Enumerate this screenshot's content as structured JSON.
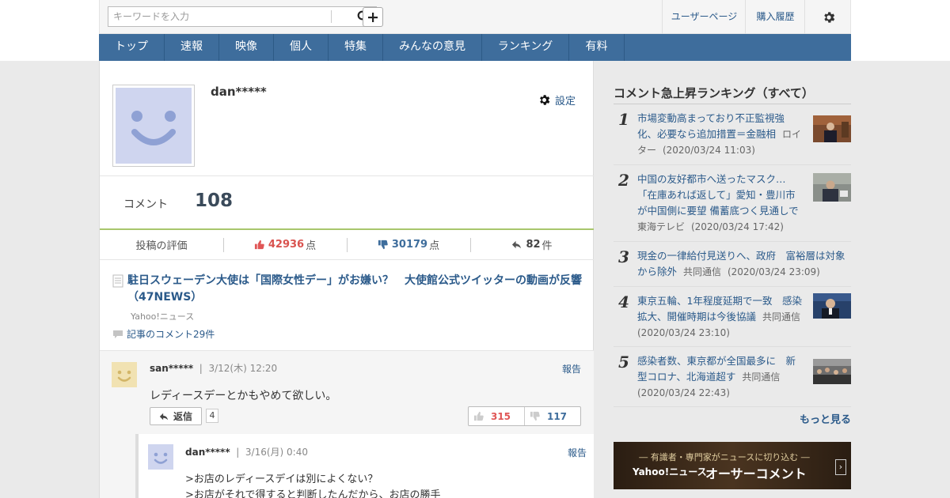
{
  "header": {
    "search_placeholder": "キーワードを入力",
    "user_page": "ユーザーページ",
    "purchase_history": "購入履歴",
    "icons": [
      "search-icon",
      "plus-icon",
      "gear-icon"
    ]
  },
  "nav": {
    "tabs": [
      {
        "label": "トップ"
      },
      {
        "label": "速報"
      },
      {
        "label": "映像"
      },
      {
        "label": "個人"
      },
      {
        "label": "特集"
      },
      {
        "label": "みんなの意見"
      },
      {
        "label": "ランキング"
      },
      {
        "label": "有料"
      }
    ]
  },
  "profile": {
    "username": "dan*****",
    "settings_label": "設定",
    "comment_label": "コメント",
    "comment_count": "108"
  },
  "stats": {
    "rating_label": "投稿の評価",
    "good": "42936",
    "bad": "30179",
    "replies": "82",
    "points_unit": "点",
    "count_unit": "件"
  },
  "article": {
    "title": "駐日スウェーデン大使は「国際女性デー」がお嫌い？　大使館公式ツイッターの動画が反響（47NEWS）",
    "source": "Yahoo!ニュース",
    "comments_link": "記事のコメント29件"
  },
  "comment": {
    "user": "san*****",
    "date": "3/12(木) 12:20",
    "report": "報告",
    "text": "レディースデーとかもやめて欲しい。",
    "reply_label": "返信",
    "reply_count": "4",
    "good": "315",
    "bad": "117"
  },
  "reply": {
    "user": "dan*****",
    "date": "3/16(月) 0:40",
    "report": "報告",
    "line1": ">お店のレディースデイは別によくない？",
    "line2": ">お店がそれで得すると判断したんだから、お店の勝手"
  },
  "sidebar": {
    "title": "コメント急上昇ランキング（すべて）",
    "items": [
      {
        "rank": "1",
        "title": "市場変動高まっており不正監視強化、必要なら追加措置＝金融相",
        "source": "ロイター",
        "time": "(2020/03/24 11:03)",
        "has_thumb": true
      },
      {
        "rank": "2",
        "title": "中国の友好都市へ送ったマスク… 「在庫あれば返して」愛知・豊川市が中国側に要望 備蓄底つく見通しで",
        "source": "東海テレビ",
        "time": "(2020/03/24 17:42)",
        "has_thumb": true
      },
      {
        "rank": "3",
        "title": "現金の一律給付見送りへ、政府　富裕層は対象から除外",
        "source": "共同通信",
        "time": "(2020/03/24 23:09)",
        "has_thumb": false
      },
      {
        "rank": "4",
        "title": "東京五輪、1年程度延期で一致　感染拡大、開催時期は今後協議",
        "source": "共同通信",
        "time": "(2020/03/24 23:10)",
        "has_thumb": true
      },
      {
        "rank": "5",
        "title": "感染者数、東京都が全国最多に　新型コロナ、北海道超す",
        "source": "共同通信",
        "time": "(2020/03/24 22:43)",
        "has_thumb": true
      }
    ],
    "more": "もっと見る"
  },
  "banner": {
    "line1": "― 有識者・専門家がニュースに切り込む ―",
    "brand": "Yahoo!ニュース",
    "headline": "オーサーコメント",
    "arrow": "›"
  }
}
